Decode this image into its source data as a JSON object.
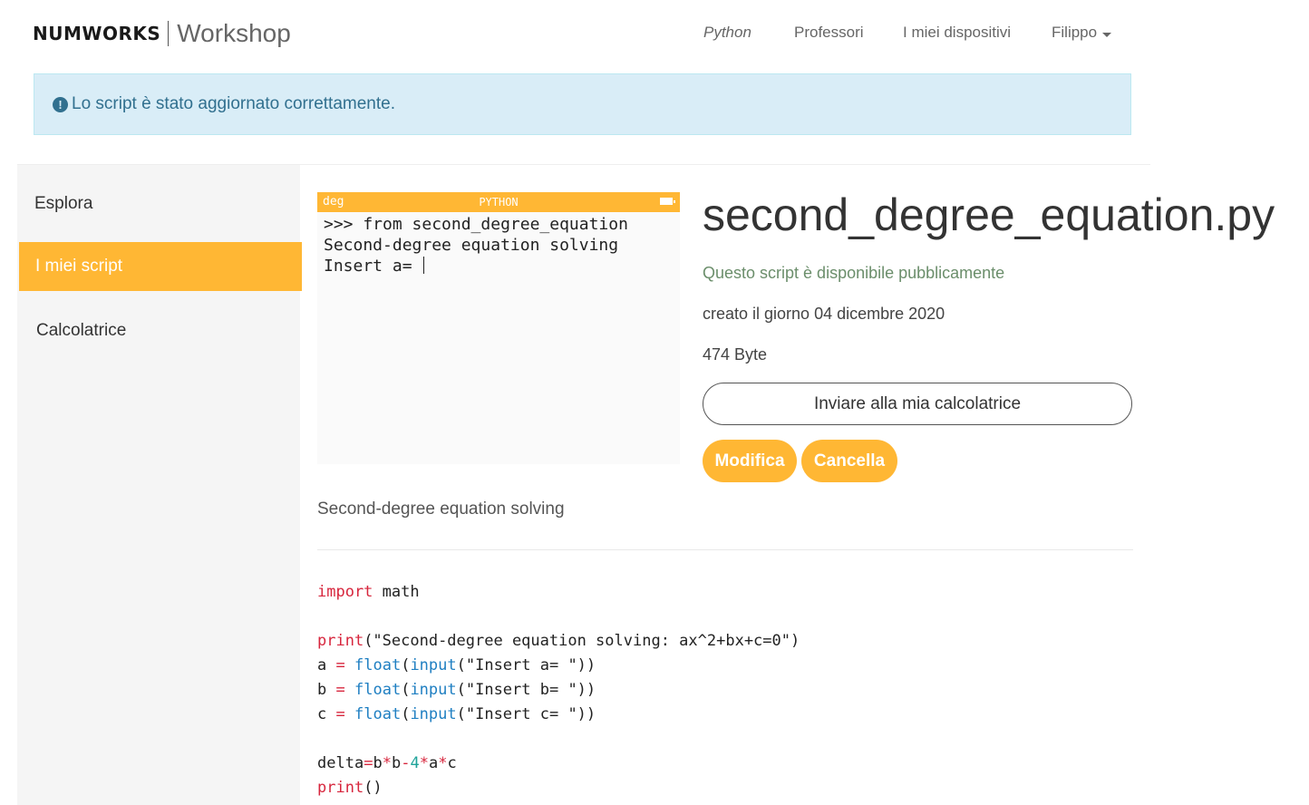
{
  "header": {
    "brand_logo": "NUMWORKS",
    "brand_sub": "Workshop",
    "nav": {
      "python": "Python",
      "professors": "Professori",
      "devices": "I miei dispositivi",
      "user": "Filippo"
    }
  },
  "alert": {
    "icon": "exclamation-circle-icon",
    "message": "Lo script è stato aggiornato correttamente."
  },
  "sidebar": {
    "items": [
      {
        "label": "Esplora"
      },
      {
        "label": "I miei script",
        "active": true
      },
      {
        "label": "Calcolatrice"
      }
    ]
  },
  "simulator": {
    "angle_mode": "deg",
    "app": "PYTHON",
    "lines": [
      ">>> from second_degree_equation",
      "Second-degree equation solving",
      "Insert a= "
    ]
  },
  "script": {
    "title": "second_degree_equation.py",
    "visibility": "Questo script è disponibile pubblicamente",
    "created": "creato il giorno 04 dicembre 2020",
    "size": "474 Byte",
    "send_label": "Inviare alla mia calcolatrice",
    "edit_label": "Modifica",
    "delete_label": "Cancella",
    "description": "Second-degree equation solving"
  },
  "code": {
    "l1_kw": "import",
    "l1_rest": " math",
    "l3_fn": "print",
    "l3_rest": "(\"Second-degree equation solving: ax^2+bx+c=0\")",
    "l4": "a",
    "l5": "b",
    "l6": "c",
    "eq": "=",
    "float": "float",
    "input": "input",
    "prompt_a": "(\"Insert a= \"))",
    "prompt_b": "(\"Insert b= \"))",
    "prompt_c": "(\"Insert c= \"))",
    "delta_a": "delta",
    "delta_b": "b",
    "delta_c": "b",
    "delta_d": "4",
    "delta_e": "a",
    "delta_f": "c",
    "l9_fn": "print",
    "l9_rest": "()"
  },
  "colors": {
    "accent": "#ffb734",
    "alert_bg": "#d9edf7",
    "alert_text": "#31708f"
  }
}
